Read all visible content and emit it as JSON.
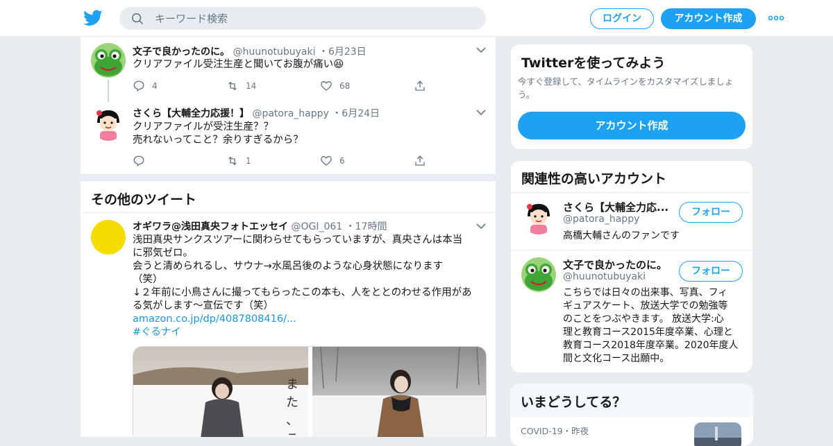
{
  "header": {
    "search_placeholder": "キーワード検索",
    "login_label": "ログイン",
    "signup_label": "アカウント作成"
  },
  "thread": [
    {
      "name": "文子で良かったのに。",
      "handle": "@huunotubuyaki",
      "time": "6月23日",
      "text": "クリアファイル受注生産と聞いてお腹が痛い😆",
      "replies": "4",
      "retweets": "14",
      "likes": "68"
    },
    {
      "name": "さくら【大輔全力応援！】",
      "handle": "@patora_happy",
      "time": "6月24日",
      "text_line1": "クリアファイルが受注生産？？",
      "text_line2": "売れないってこと？余りすぎるから？",
      "replies": "",
      "retweets": "1",
      "likes": "6"
    }
  ],
  "more_tweets": {
    "title": "その他のツイート",
    "tweet": {
      "name": "オギワラ@浅田真央フォトエッセイ",
      "handle": "@OGI_061",
      "time": "17時間",
      "line1": "浅田真央サンクスツアーに関わらせてもらっていますが、真央さんは本当",
      "line2": "に邪気ゼロ。",
      "line3": "会うと清められるし、サウナ→水風呂後のような心身状態になります",
      "line4": "（笑）",
      "line5": "↓２年前に小鳥さんに撮ってもらったこの本も、人をととのわせる作用があ",
      "line6": "る気がします〜宣伝です（笑）",
      "link": "amazon.co.jp/dp/4087808416/...",
      "hashtag": "#ぐるナイ"
    },
    "book_cover_text": "また、この"
  },
  "signup_card": {
    "title": "Twitterを使ってみよう",
    "desc": "今すぐ登録して、タイムラインをカスタマイズしましょう。",
    "button": "アカウント作成"
  },
  "related": {
    "title": "関連性の高いアカウント",
    "follow_label": "フォロー",
    "accounts": [
      {
        "name": "さくら【大輔全力応...",
        "handle": "@patora_happy",
        "bio": "高橋大輔さんのファンです"
      },
      {
        "name": "文子で良かったのに。",
        "handle": "@huunotubuyaki",
        "bio_lines": [
          "こちらでは日々の出来事、写真、フィ",
          "ギュアスケート、放送大学での勉強等",
          "のことをつぶやきます。 放送大学:心",
          "理と教育コース2015年度卒業、心理と",
          "教育コース2018年度卒業。2020年度人",
          "間と文化コース出願中。"
        ]
      }
    ]
  },
  "trends": {
    "title": "いまどうしてる？",
    "item_category": "COVID-19",
    "item_time": "昨夜"
  },
  "colors": {
    "accent": "#1da1f2",
    "text": "#14171a",
    "secondary": "#657786",
    "border": "#e6ecf0",
    "frog_green": "#3fa535",
    "yellow_avatar": "#f5dc00"
  }
}
